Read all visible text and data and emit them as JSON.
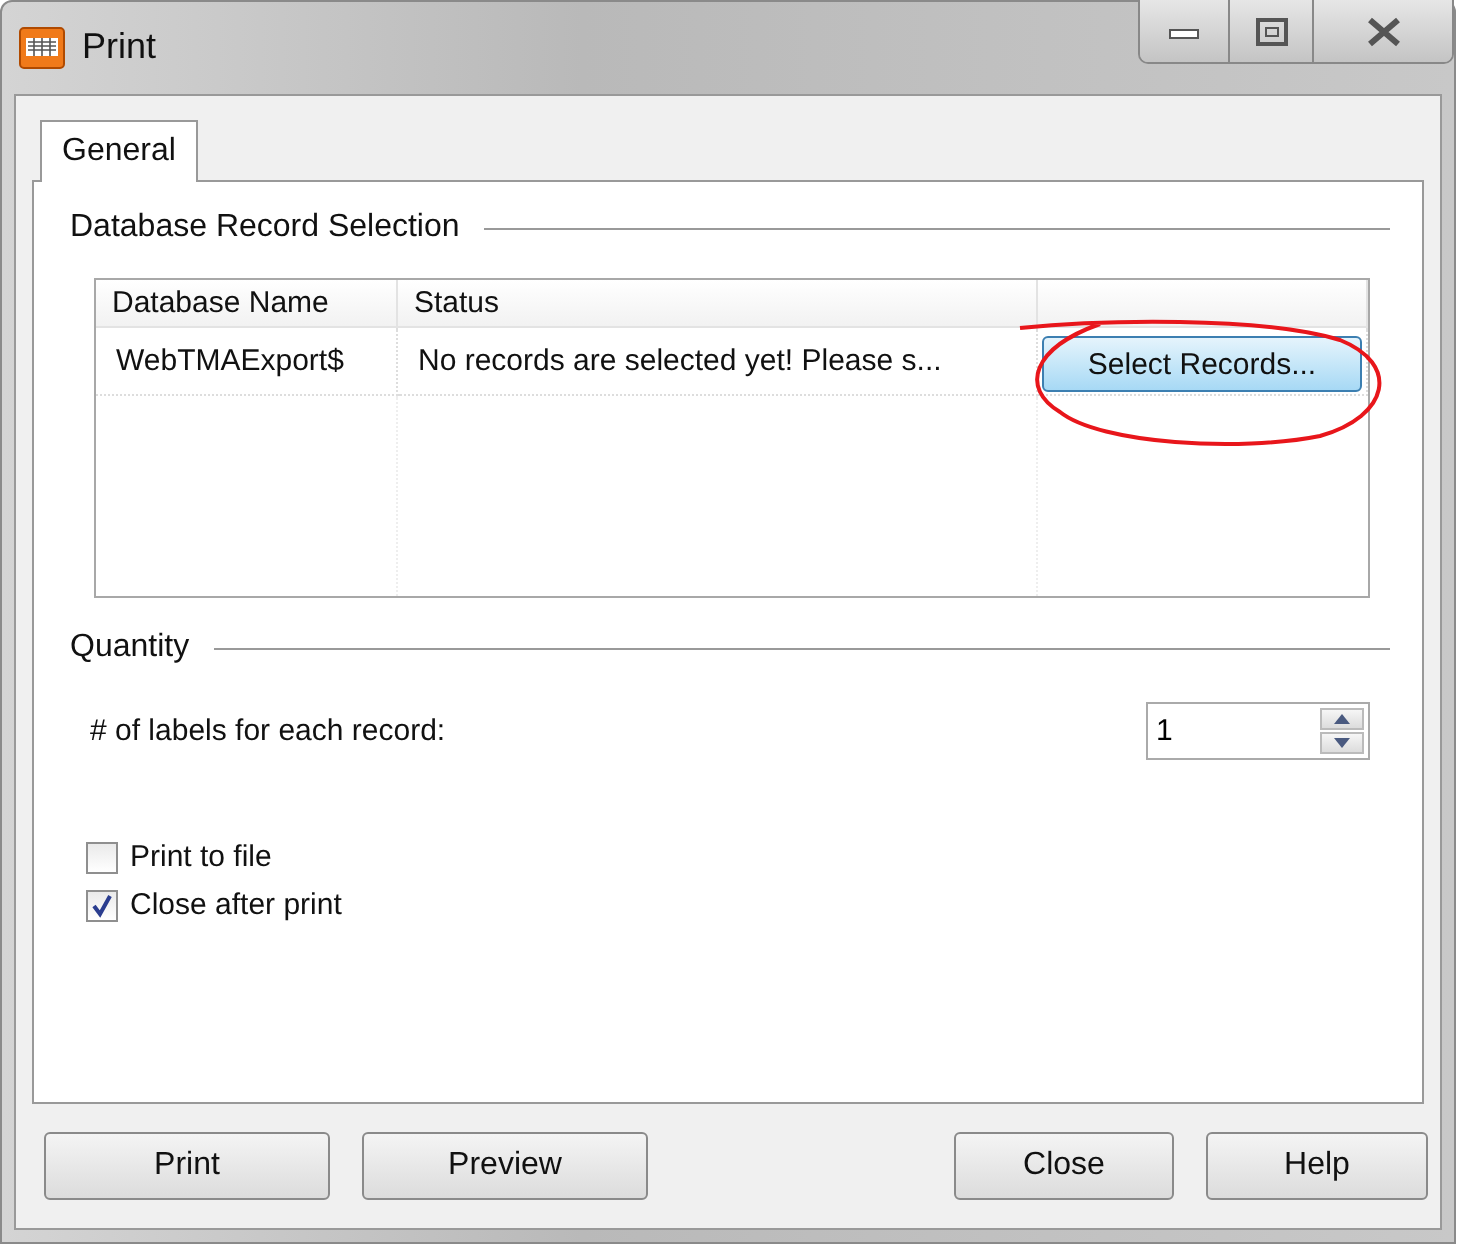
{
  "window": {
    "title": "Print"
  },
  "tabs": [
    {
      "label": "General",
      "selected": true
    }
  ],
  "record_selection": {
    "title": "Database Record Selection",
    "columns": [
      "Database Name",
      "Status"
    ],
    "rows": [
      {
        "database_name": "WebTMAExport$",
        "status": "No records are selected yet! Please s...",
        "action": "Select Records...",
        "annotated": true
      }
    ]
  },
  "quantity": {
    "title": "Quantity",
    "label": "# of labels for each record:",
    "value": "1"
  },
  "options": [
    {
      "label": "Print to file",
      "checked": false
    },
    {
      "label": "Close after print",
      "checked": true
    }
  ],
  "buttons_left": [
    "Print",
    "Preview"
  ],
  "buttons_right": [
    "Close",
    "Help"
  ]
}
